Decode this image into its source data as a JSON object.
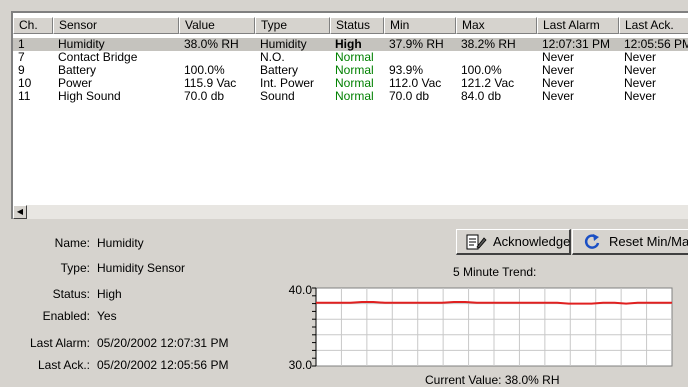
{
  "table": {
    "columns": [
      "Ch.",
      "Sensor",
      "Value",
      "Type",
      "Status",
      "Min",
      "Max",
      "Last Alarm",
      "Last Ack."
    ],
    "rows": [
      {
        "ch": "1",
        "sensor": "Humidity",
        "value": "38.0% RH",
        "type": "Humidity",
        "status": "High",
        "min": "37.9% RH",
        "max": "38.2% RH",
        "last_alarm": "12:07:31 PM",
        "last_ack": "12:05:56 PM"
      },
      {
        "ch": "7",
        "sensor": "Contact Bridge",
        "value": "",
        "type": "N.O.",
        "status": "Normal",
        "min": "",
        "max": "",
        "last_alarm": "Never",
        "last_ack": "Never"
      },
      {
        "ch": "9",
        "sensor": "Battery",
        "value": "100.0%",
        "type": "Battery",
        "status": "Normal",
        "min": "93.9%",
        "max": "100.0%",
        "last_alarm": "Never",
        "last_ack": "Never"
      },
      {
        "ch": "10",
        "sensor": "Power",
        "value": "115.9 Vac",
        "type": "Int. Power",
        "status": "Normal",
        "min": "112.0 Vac",
        "max": "121.2 Vac",
        "last_alarm": "Never",
        "last_ack": "Never"
      },
      {
        "ch": "11",
        "sensor": "High Sound",
        "value": "70.0 db",
        "type": "Sound",
        "status": "Normal",
        "min": "70.0 db",
        "max": "84.0 db",
        "last_alarm": "Never",
        "last_ack": "Never"
      }
    ],
    "selected_row": 0
  },
  "details": {
    "name_label": "Name:",
    "name": "Humidity",
    "type_label": "Type:",
    "type": "Humidity Sensor",
    "status_label": "Status:",
    "status": "High",
    "enabled_label": "Enabled:",
    "enabled": "Yes",
    "last_alarm_label": "Last Alarm:",
    "last_alarm": "05/20/2002 12:07:31 PM",
    "last_ack_label": "Last Ack.:",
    "last_ack": "05/20/2002 12:05:56 PM"
  },
  "buttons": {
    "acknowledge": "Acknowledge",
    "reset": "Reset Min/Max"
  },
  "trend": {
    "title": "5 Minute Trend:",
    "y_max_label": "40.0",
    "y_min_label": "30.0",
    "current_value": "Current Value: 38.0% RH"
  },
  "chart_data": {
    "type": "line",
    "ylim": [
      30.0,
      40.0
    ],
    "grid": true,
    "line_color": "#e02020",
    "series": [
      {
        "values": [
          38.1,
          38.1,
          38.1,
          38.1,
          38.2,
          38.2,
          38.1,
          38.1,
          38.1,
          38.1,
          38.1,
          38.1,
          38.2,
          38.2,
          38.1,
          38.1,
          38.1,
          38.1,
          38.1,
          38.1,
          38.1,
          38.1,
          38.0,
          38.0,
          38.0,
          38.1,
          38.1,
          38.0,
          38.1,
          38.1,
          38.1,
          38.1
        ]
      }
    ]
  },
  "colors": {
    "window_bg": "#d6d3ce",
    "normal_status": "#008000",
    "selected_row": "#c5c3be",
    "trend_line": "#e02020"
  }
}
